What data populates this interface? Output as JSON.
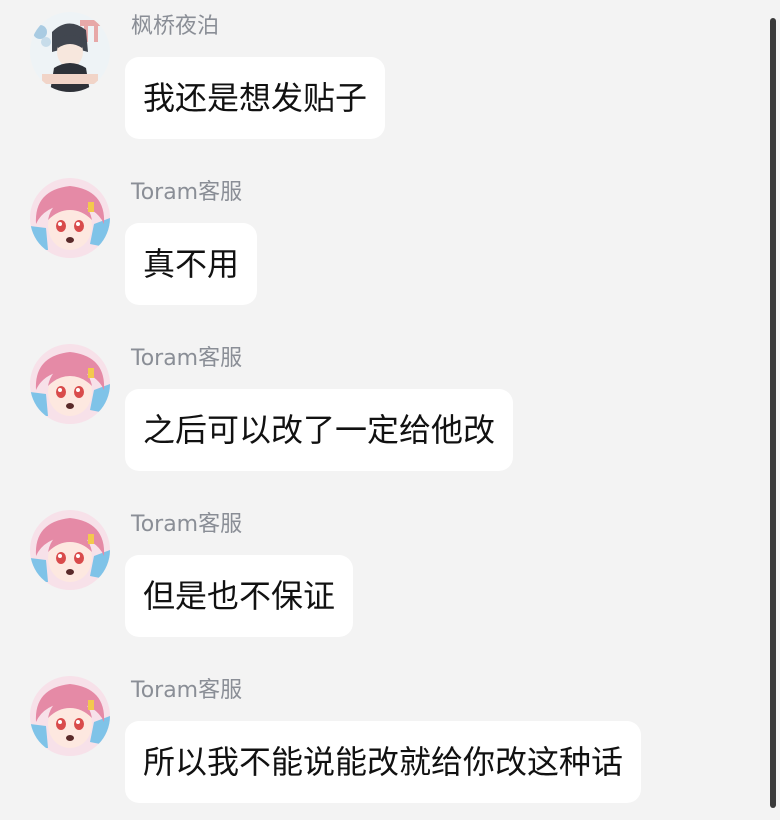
{
  "messages": [
    {
      "sender": "枫桥夜泊",
      "text": "我还是想发贴子",
      "avatar": "user-avatar"
    },
    {
      "sender": "Toram客服",
      "text": "真不用",
      "avatar": "support-avatar"
    },
    {
      "sender": "Toram客服",
      "text": "之后可以改了一定给他改",
      "avatar": "support-avatar"
    },
    {
      "sender": "Toram客服",
      "text": "但是也不保证",
      "avatar": "support-avatar"
    },
    {
      "sender": "Toram客服",
      "text": "所以我不能说能改就给你改这种话",
      "avatar": "support-avatar"
    }
  ],
  "colors": {
    "background": "#f3f3f3",
    "bubble": "#ffffff",
    "sender_name": "#8a8e96",
    "message_text": "#111111"
  }
}
